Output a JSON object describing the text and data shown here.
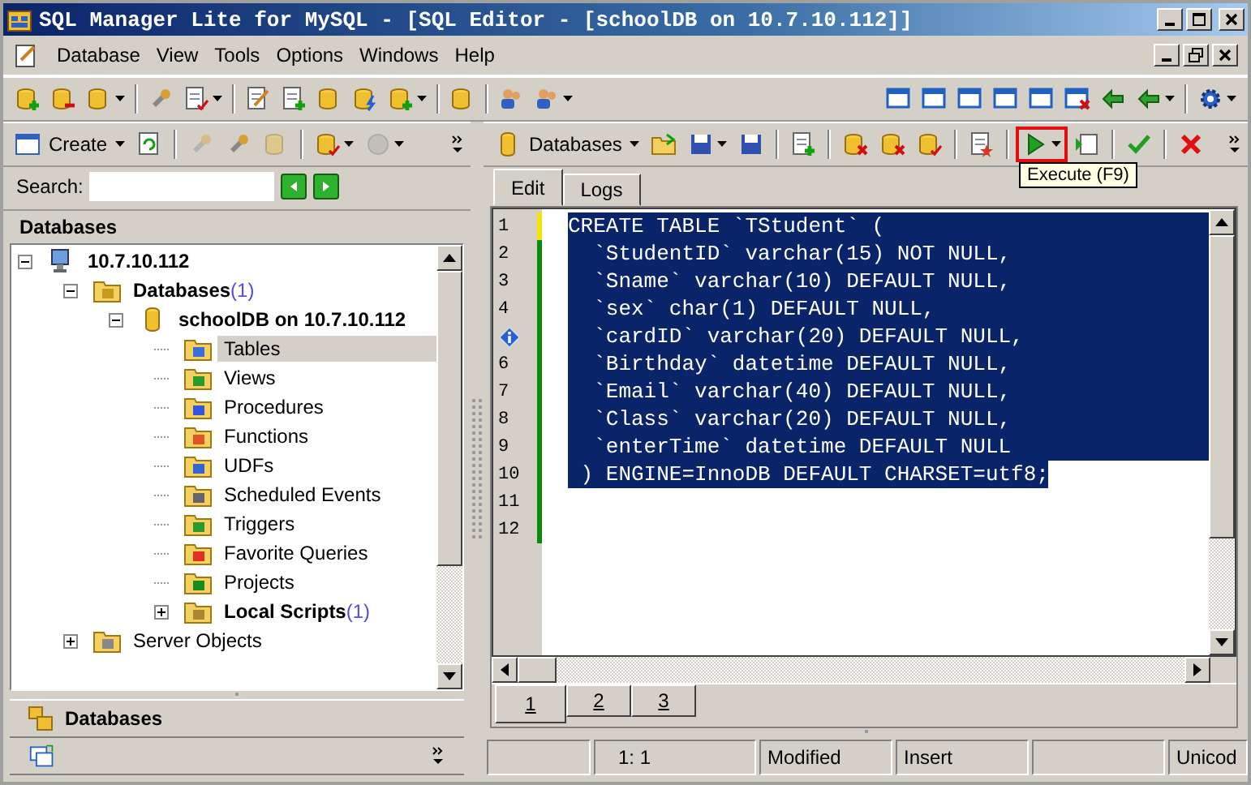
{
  "window": {
    "title": "SQL Manager Lite for MySQL - [SQL Editor - [schoolDB on 10.7.10.112]]"
  },
  "menu": {
    "items": [
      "Database",
      "View",
      "Tools",
      "Options",
      "Windows",
      "Help"
    ]
  },
  "explorer_toolbar": {
    "create_label": "Create"
  },
  "search": {
    "label": "Search:"
  },
  "explorer": {
    "title": "Databases",
    "tree": [
      {
        "label": "10.7.10.112",
        "kind": "server",
        "bold": true,
        "expanded": true,
        "selected": false,
        "children": [
          {
            "label": "Databases",
            "count": "(1)",
            "kind": "db-folder",
            "bold": true,
            "expanded": true,
            "selected": false,
            "children": [
              {
                "label": "schoolDB on 10.7.10.112",
                "kind": "database",
                "bold": true,
                "expanded": true,
                "selected": false,
                "children": [
                  {
                    "label": "Tables",
                    "kind": "tables",
                    "bold": false,
                    "selected": true
                  },
                  {
                    "label": "Views",
                    "kind": "views",
                    "bold": false,
                    "selected": false
                  },
                  {
                    "label": "Procedures",
                    "kind": "procedures",
                    "bold": false,
                    "selected": false
                  },
                  {
                    "label": "Functions",
                    "kind": "functions",
                    "bold": false,
                    "selected": false
                  },
                  {
                    "label": "UDFs",
                    "kind": "udfs",
                    "bold": false,
                    "selected": false
                  },
                  {
                    "label": "Scheduled Events",
                    "kind": "events",
                    "bold": false,
                    "selected": false
                  },
                  {
                    "label": "Triggers",
                    "kind": "triggers",
                    "bold": false,
                    "selected": false
                  },
                  {
                    "label": "Favorite Queries",
                    "kind": "favorites",
                    "bold": false,
                    "selected": false
                  },
                  {
                    "label": "Projects",
                    "kind": "projects",
                    "bold": false,
                    "selected": false
                  },
                  {
                    "label": "Local Scripts",
                    "count": "(1)",
                    "kind": "scripts",
                    "bold": true,
                    "expanded": false,
                    "selected": false
                  }
                ]
              }
            ]
          },
          {
            "label": "Server Objects",
            "kind": "server-objects",
            "bold": false,
            "expanded": false,
            "selected": false
          }
        ]
      }
    ]
  },
  "navbar": {
    "label": "Databases"
  },
  "editor_toolbar": {
    "databases_label": "Databases",
    "execute_highlighted": true,
    "tooltip": "Execute (F9)"
  },
  "tabs": [
    {
      "label": "Edit",
      "selected": true
    },
    {
      "label": "Logs",
      "selected": false
    }
  ],
  "editor": {
    "lines": [
      {
        "number": "1",
        "text": "CREATE TABLE `TStudent` (",
        "selected": true,
        "unsaved": true,
        "info_marker": false
      },
      {
        "number": "2",
        "text": "  `StudentID` varchar(15) NOT NULL,",
        "selected": true,
        "unsaved": false,
        "info_marker": false
      },
      {
        "number": "3",
        "text": "  `Sname` varchar(10) DEFAULT NULL,",
        "selected": true,
        "unsaved": false,
        "info_marker": false
      },
      {
        "number": "4",
        "text": "  `sex` char(1) DEFAULT NULL,",
        "selected": true,
        "unsaved": false,
        "info_marker": false
      },
      {
        "text": "  `cardID` varchar(20) DEFAULT NULL,",
        "selected": true,
        "unsaved": false,
        "info_marker": true
      },
      {
        "number": "6",
        "text": "  `Birthday` datetime DEFAULT NULL,",
        "selected": true,
        "unsaved": false,
        "info_marker": false
      },
      {
        "number": "7",
        "text": "  `Email` varchar(40) DEFAULT NULL,",
        "selected": true,
        "unsaved": false,
        "info_marker": false
      },
      {
        "number": "8",
        "text": "  `Class` varchar(20) DEFAULT NULL,",
        "selected": true,
        "unsaved": false,
        "info_marker": false
      },
      {
        "number": "9",
        "text": "  `enterTime` datetime DEFAULT NULL",
        "selected": true,
        "unsaved": false,
        "info_marker": false
      },
      {
        "number": "10",
        "text": " ) ENGINE=InnoDB DEFAULT CHARSET=utf8;",
        "selected": true,
        "unsaved": false,
        "info_marker": false
      },
      {
        "number": "11",
        "selected": false,
        "unsaved": false,
        "info_marker": false
      },
      {
        "number": "12",
        "selected": false,
        "unsaved": false,
        "info_marker": false
      }
    ]
  },
  "page_tabs": [
    {
      "label": "1",
      "selected": true
    },
    {
      "label": "2",
      "selected": false
    },
    {
      "label": "3",
      "selected": false
    }
  ],
  "status_bar": [
    {
      "kind": "blank"
    },
    {
      "kind": "text",
      "text": "1:   1"
    },
    {
      "kind": "text",
      "text": "Modified"
    },
    {
      "kind": "text",
      "text": "Insert"
    },
    {
      "kind": "blank"
    },
    {
      "kind": "text",
      "text": "Unicod"
    }
  ]
}
